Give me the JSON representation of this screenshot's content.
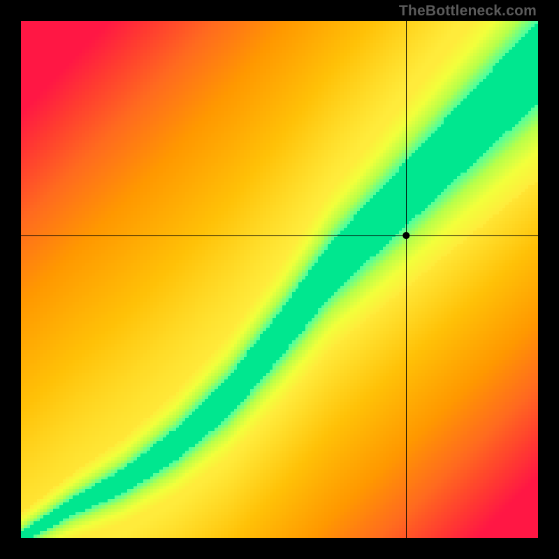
{
  "watermark": "TheBottleneck.com",
  "chart_data": {
    "type": "heatmap",
    "title": "",
    "xlabel": "",
    "ylabel": "",
    "xlim": [
      0,
      1
    ],
    "ylim": [
      0,
      1
    ],
    "crosshair": {
      "x_frac": 0.745,
      "y_frac": 0.585
    },
    "marker": {
      "x_frac": 0.745,
      "y_frac": 0.585,
      "radius_px": 5,
      "fill": "#000000"
    },
    "colorscale": [
      {
        "stop": 0.0,
        "color": "#ff1744"
      },
      {
        "stop": 0.06,
        "color": "#ff3b30"
      },
      {
        "stop": 0.14,
        "color": "#ff6a1f"
      },
      {
        "stop": 0.25,
        "color": "#ff9800"
      },
      {
        "stop": 0.4,
        "color": "#ffc107"
      },
      {
        "stop": 0.55,
        "color": "#ffeb3b"
      },
      {
        "stop": 0.68,
        "color": "#f2ff3b"
      },
      {
        "stop": 0.8,
        "color": "#b7ff4a"
      },
      {
        "stop": 0.9,
        "color": "#4cffa0"
      },
      {
        "stop": 1.0,
        "color": "#00e78f"
      }
    ],
    "ridge": {
      "description": "Optimal (green) band follows a superlinear curve from bottom-left to top-right; green band width grows with x.",
      "control_points_xy_frac": [
        [
          0.0,
          0.0
        ],
        [
          0.1,
          0.06
        ],
        [
          0.2,
          0.11
        ],
        [
          0.3,
          0.18
        ],
        [
          0.4,
          0.27
        ],
        [
          0.5,
          0.39
        ],
        [
          0.6,
          0.52
        ],
        [
          0.7,
          0.62
        ],
        [
          0.8,
          0.72
        ],
        [
          0.9,
          0.82
        ],
        [
          1.0,
          0.92
        ]
      ],
      "green_halfwidth_frac": {
        "at_x0": 0.01,
        "at_x1": 0.08
      }
    },
    "pixel_grid": 160,
    "background_bias": {
      "top_left": 0.0,
      "bottom_right": 0.0,
      "center": 0.35
    }
  }
}
